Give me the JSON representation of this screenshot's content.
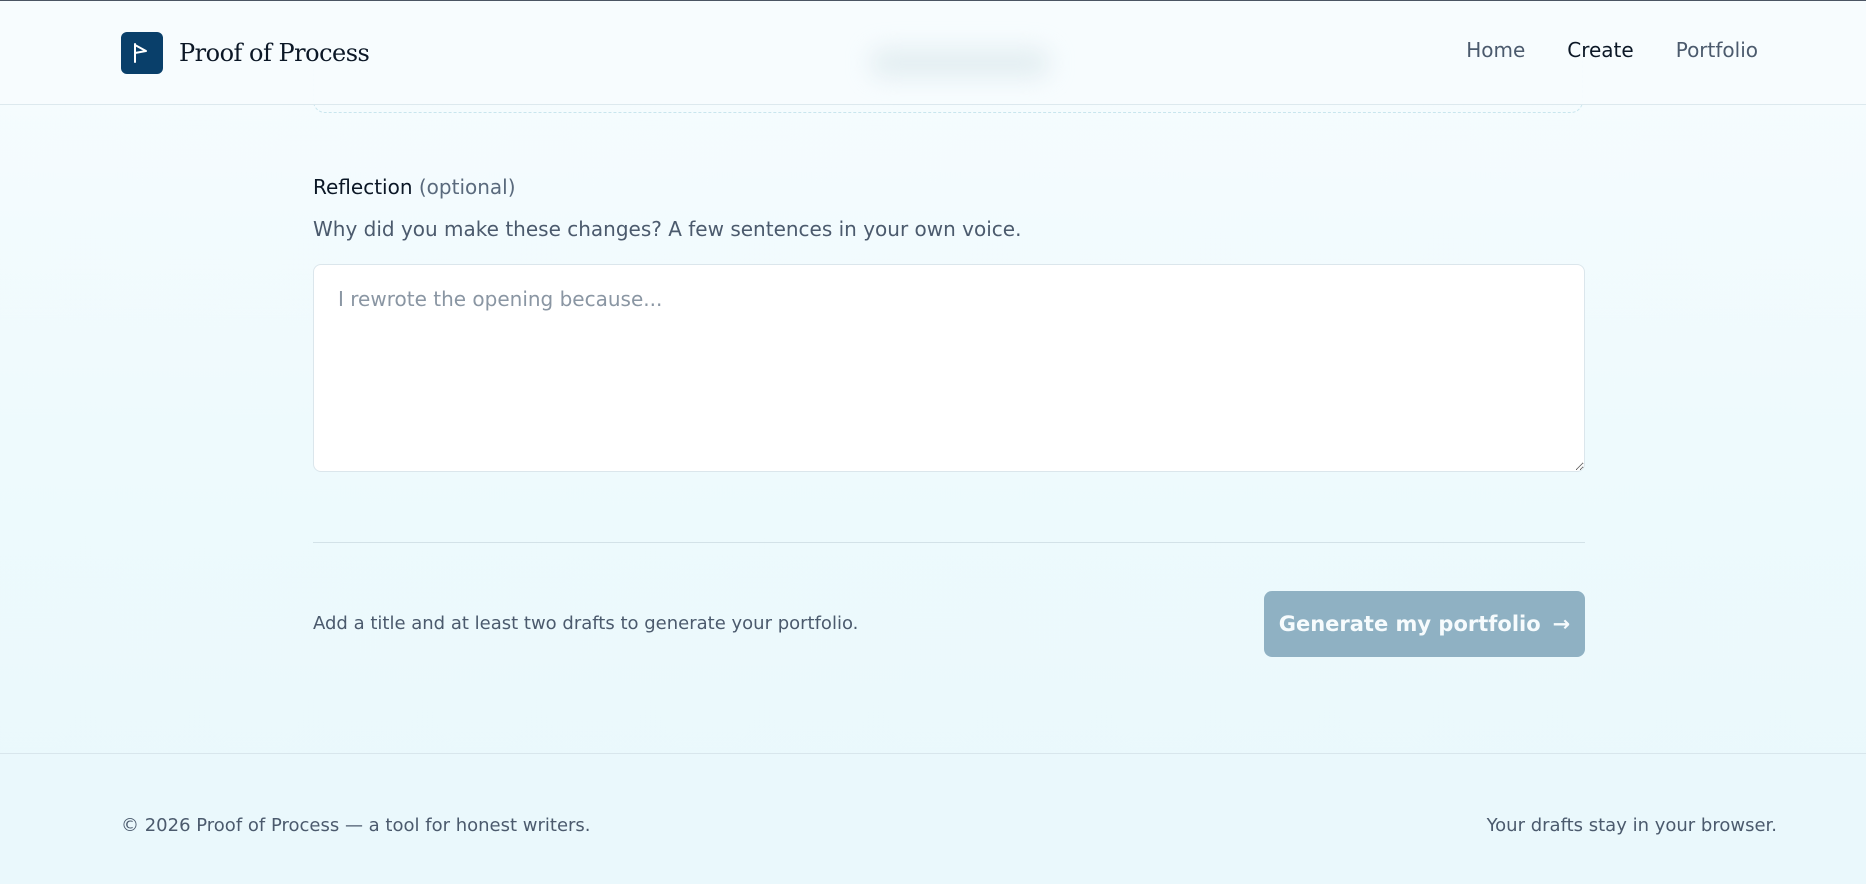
{
  "header": {
    "brand": "Proof of Process",
    "brand_color": "#093f6a",
    "logo_icon": "flag-icon",
    "nav": [
      {
        "label": "Home",
        "active": false
      },
      {
        "label": "Create",
        "active": true
      },
      {
        "label": "Portfolio",
        "active": false
      }
    ]
  },
  "reflection": {
    "label": "Reflection",
    "optional": "(optional)",
    "help": "Why did you make these changes? A few sentences in your own voice.",
    "placeholder": "I rewrote the opening because...",
    "value": ""
  },
  "actions": {
    "hint": "Add a title and at least two drafts to generate your portfolio.",
    "generate_label": "Generate my portfolio",
    "generate_icon": "arrow-right-icon",
    "generate_arrow": "→",
    "button_color": "#8fb1c3",
    "disabled": true
  },
  "footer": {
    "left": "© 2026 Proof of Process — a tool for honest writers.",
    "right": "Your drafts stay in your browser."
  }
}
